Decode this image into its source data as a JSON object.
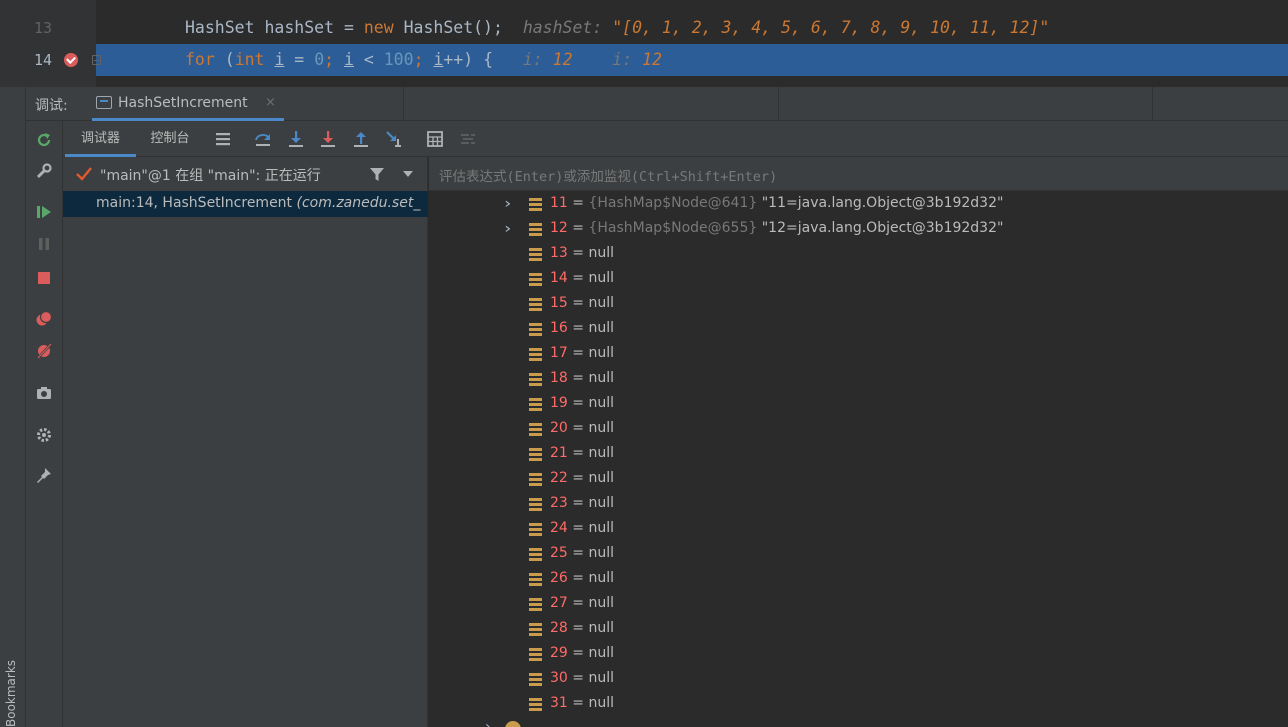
{
  "editor": {
    "line13": {
      "number": "13",
      "code_type": "HashSet",
      "code_var": "hashSet",
      "code_eq": " = ",
      "code_new": "new",
      "code_rest": " HashSet();",
      "inline_name": "hashSet:",
      "inline_value": "\"[0, 1, 2, 3, 4, 5, 6, 7, 8, 9, 10, 11, 12]\""
    },
    "line14": {
      "number": "14",
      "kw_for": "for",
      "p1": " (",
      "kw_int": "int",
      "v1": "i",
      "p2": " = ",
      "n0": "0",
      "p3": "; ",
      "v2": "i",
      "p4": " < ",
      "n100": "100",
      "p5": "; ",
      "v3": "i",
      "p6": "++) {",
      "hint1_name": "i:",
      "hint1_val": "12",
      "hint2_name": "i:",
      "hint2_val": "12"
    }
  },
  "debug_bar": {
    "label": "调试:",
    "run_tab": "HashSetIncrement",
    "close": "×"
  },
  "subtabs": {
    "debugger": "调试器",
    "console": "控制台"
  },
  "frames": {
    "thread": "\"main\"@1 在组 \"main\": 正在运行",
    "frame_main": "main:14, HashSetIncrement ",
    "frame_pkg": "(com.zanedu.set_"
  },
  "watch": {
    "placeholder": "评估表达式(Enter)或添加监视(Ctrl+Shift+Enter)"
  },
  "variables": {
    "node_rows": [
      {
        "index": "11",
        "type": "{HashMap$Node@641}",
        "value": "\"11=java.lang.Object@3b192d32\""
      },
      {
        "index": "12",
        "type": "{HashMap$Node@655}",
        "value": "\"12=java.lang.Object@3b192d32\""
      }
    ],
    "null_rows": [
      "13",
      "14",
      "15",
      "16",
      "17",
      "18",
      "19",
      "20",
      "21",
      "22",
      "23",
      "24",
      "25",
      "26",
      "27",
      "28",
      "29",
      "30",
      "31"
    ],
    "eq": " = ",
    "null": "null"
  },
  "left_strip": {
    "bookmarks": "Bookmarks"
  },
  "colors": {
    "selection": "#2d5d96",
    "accent": "#4a88c7",
    "index_red": "#ff6b68",
    "keyword_orange": "#cc7832"
  }
}
